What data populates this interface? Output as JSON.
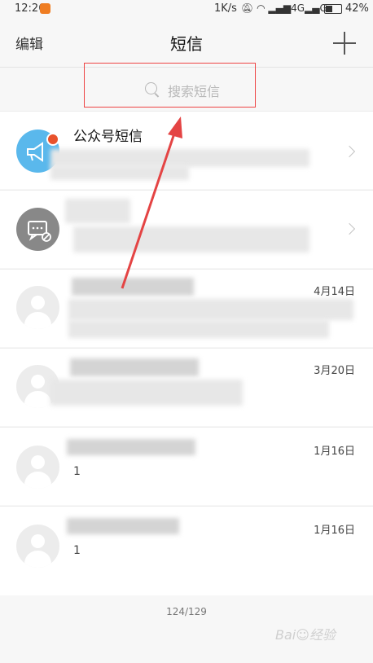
{
  "status_bar": {
    "time": "12:26",
    "speed": "1K/s",
    "signal": "4G",
    "network_type": "G",
    "battery": "42%",
    "icons": [
      "notification-icon",
      "mute-bell-icon",
      "wifi-icon",
      "signal-icon",
      "battery-icon"
    ]
  },
  "header": {
    "edit": "编辑",
    "title": "短信",
    "add_icon": "plus-icon"
  },
  "search": {
    "placeholder": "搜索短信",
    "icon": "search-icon"
  },
  "conversations": [
    {
      "name": "公众号短信",
      "date": "",
      "preview": ""
    },
    {
      "name": "",
      "date": "",
      "preview": ""
    },
    {
      "name": "",
      "date": "4月14日",
      "preview": ""
    },
    {
      "name": "",
      "date": "3月20日",
      "preview": ""
    },
    {
      "name": "",
      "date": "1月16日",
      "preview": "1"
    },
    {
      "name": "",
      "date": "1月16日",
      "preview": "1"
    }
  ],
  "footer": {
    "count": "124/129"
  },
  "colors": {
    "accent_blue": "#5ab8ec",
    "badge_red": "#e8522c",
    "annotation_red": "#e44444"
  }
}
